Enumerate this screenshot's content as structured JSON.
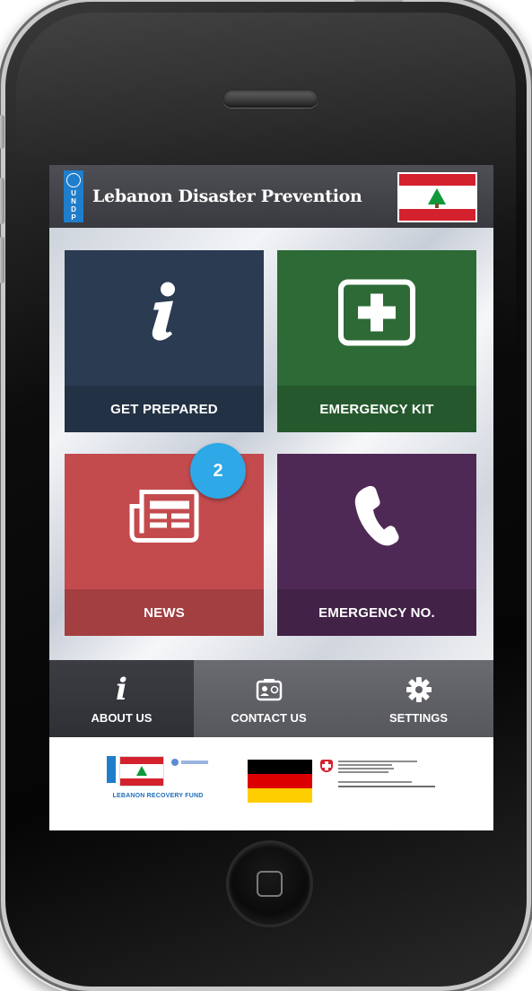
{
  "app": {
    "title": "Lebanon Disaster Prevention",
    "undp_logo_text": [
      "U",
      "N",
      "D",
      "P"
    ]
  },
  "tiles": [
    {
      "label": "GET PREPARED",
      "icon": "info-icon",
      "color": "#2a3b52"
    },
    {
      "label": "EMERGENCY KIT",
      "icon": "first-aid-kit-icon",
      "color": "#2d6a36"
    },
    {
      "label": "NEWS",
      "icon": "newspaper-icon",
      "color": "#c34b4e",
      "badge": "2"
    },
    {
      "label": "EMERGENCY NO.",
      "icon": "phone-icon",
      "color": "#4f2955"
    }
  ],
  "bottom_nav": {
    "items": [
      {
        "label": "ABOUT US",
        "icon": "info-icon",
        "active": true
      },
      {
        "label": "CONTACT US",
        "icon": "contact-card-icon",
        "active": false
      },
      {
        "label": "SETTINGS",
        "icon": "gear-icon",
        "active": false
      }
    ]
  },
  "sponsors": {
    "lrf_label": "LEBANON RECOVERY FUND"
  },
  "colors": {
    "header_bg": "#45464b",
    "nav_bg": "#5f6065",
    "nav_active_bg": "#36373c",
    "badge": "#2ea8e6"
  }
}
